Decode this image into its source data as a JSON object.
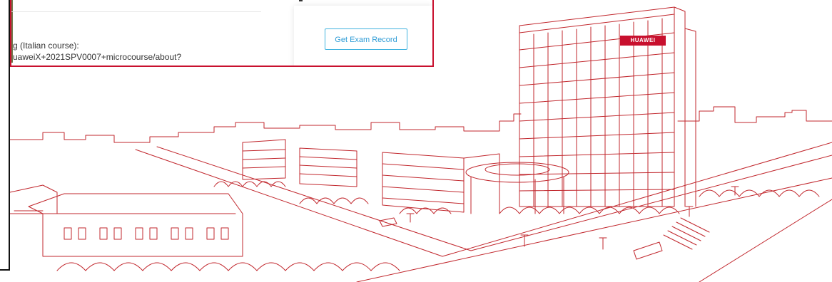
{
  "course": {
    "title_fragment": "g (Italian course):",
    "url_fragment": "uaweiX+2021SPV0007+microcourse/about?"
  },
  "exam": {
    "button_label": "Get Exam Record"
  },
  "illustration": {
    "sign_text": "HUAWEI"
  },
  "colors": {
    "accent_red": "#c8102e",
    "button_blue": "#2f9cd6",
    "line_red": "#c1272d"
  }
}
